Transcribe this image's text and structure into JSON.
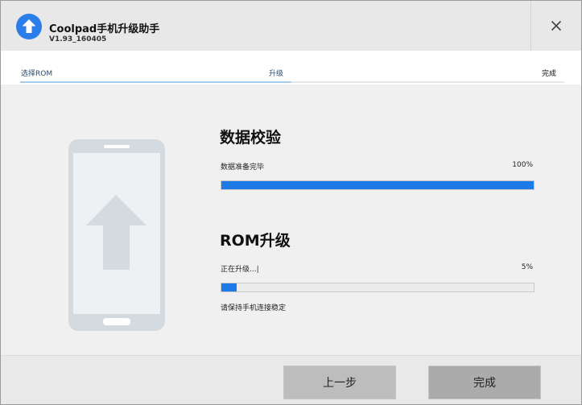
{
  "window": {
    "title": "Coolpad手机升级助手",
    "version": "V1.93_160405"
  },
  "steps": {
    "items": [
      {
        "label": "选择ROM"
      },
      {
        "label": "升级"
      },
      {
        "label": "完成"
      }
    ],
    "current_step": 2
  },
  "verify": {
    "title": "数据校验",
    "status": "数据准备完毕",
    "percent_text": "100%",
    "progress": 1.0
  },
  "upgrade": {
    "title": "ROM升级",
    "status": "正在升级...|",
    "percent_text": "5%",
    "progress": 0.05,
    "hint": "请保持手机连接稳定"
  },
  "buttons": {
    "prev": "上一步",
    "finish": "完成"
  },
  "colors": {
    "accent": "#1e7ae6",
    "icon": "#2b7de9"
  },
  "icons": {
    "app": "up-arrow-circle-icon",
    "close": "close-icon",
    "illustration": "phone-upgrade-icon"
  }
}
